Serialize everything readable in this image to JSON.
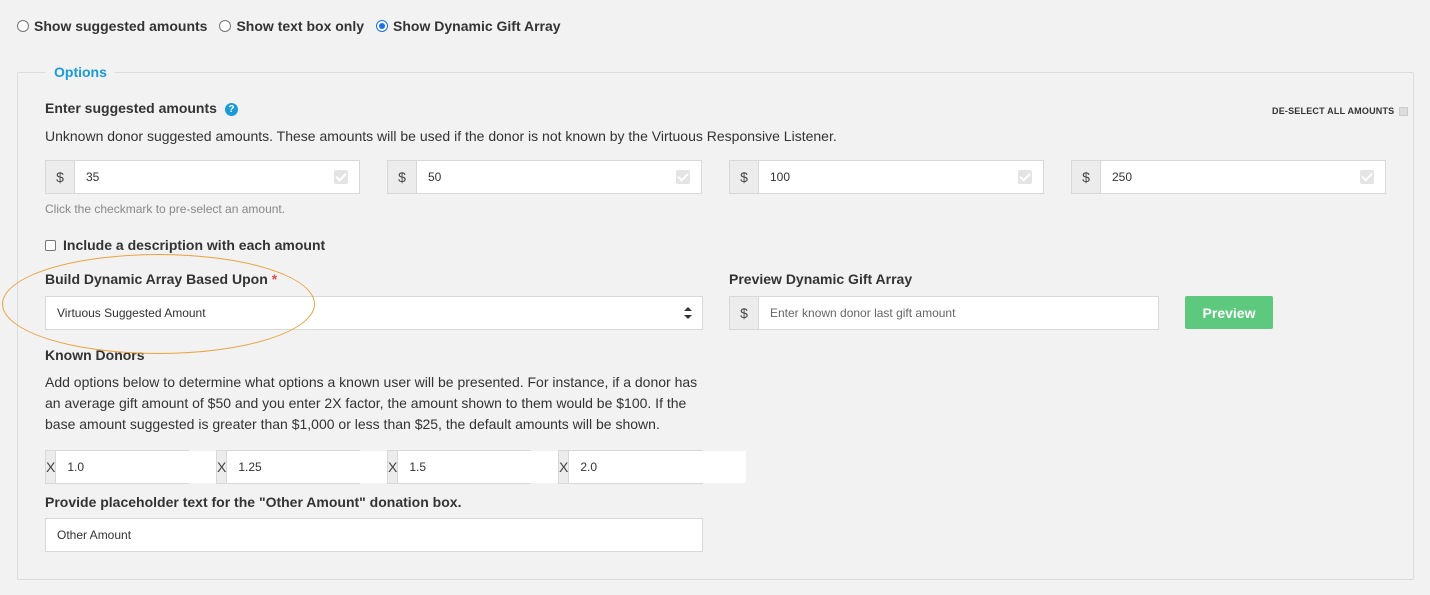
{
  "display_mode": {
    "options": [
      {
        "label": "Show suggested amounts",
        "checked": false
      },
      {
        "label": "Show text box only",
        "checked": false
      },
      {
        "label": "Show Dynamic Gift Array",
        "checked": true
      }
    ]
  },
  "options": {
    "legend": "Options",
    "suggested": {
      "title": "Enter suggested amounts",
      "help_icon": "?",
      "deselect_label": "DE-SELECT ALL AMOUNTS",
      "description": "Unknown donor suggested amounts. These amounts will be used if the donor is not known by the Virtuous Responsive Listener.",
      "currency": "$",
      "amounts": [
        "35",
        "50",
        "100",
        "250"
      ],
      "hint": "Click the checkmark to pre-select an amount."
    },
    "include_description_label": "Include a description with each amount",
    "build_array": {
      "label": "Build Dynamic Array Based Upon",
      "required_mark": "*",
      "selected": "Virtuous Suggested Amount"
    },
    "preview": {
      "label": "Preview Dynamic Gift Array",
      "currency": "$",
      "placeholder": "Enter known donor last gift amount",
      "button": "Preview"
    },
    "known_donors": {
      "title": "Known Donors",
      "description": "Add options below to determine what options a known user will be presented. For instance, if a donor has an average gift amount of $50 and you enter 2X factor, the amount shown to them would be $100. If the base amount suggested is greater than $1,000 or less than $25, the default amounts will be shown.",
      "factor_prefix": "X",
      "factors": [
        "1.0",
        "1.25",
        "1.5",
        "2.0"
      ]
    },
    "other_amount": {
      "label": "Provide placeholder text for the \"Other Amount\" donation box.",
      "value": "Other Amount"
    }
  },
  "colors": {
    "accent_blue": "#1a9bd7",
    "preview_green": "#5cc97e",
    "annotation_orange": "#e8a33c"
  }
}
